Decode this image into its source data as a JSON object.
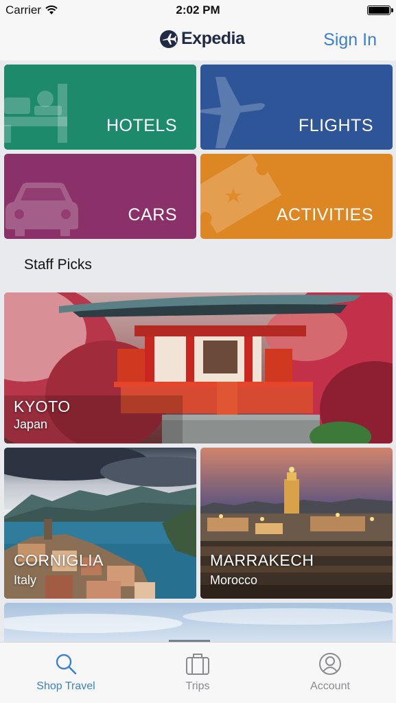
{
  "status_bar": {
    "carrier": "Carrier",
    "time": "2:02 PM"
  },
  "nav": {
    "logo": "Expedia",
    "sign_in": "Sign In"
  },
  "categories": [
    {
      "label": "HOTELS",
      "color": "#1e8a6c",
      "icon": "bed-icon"
    },
    {
      "label": "FLIGHTS",
      "color": "#2d5597",
      "icon": "airplane-icon"
    },
    {
      "label": "CARS",
      "color": "#8b3169",
      "icon": "car-icon"
    },
    {
      "label": "ACTIVITIES",
      "color": "#dd8724",
      "icon": "ticket-icon"
    }
  ],
  "staff_picks": {
    "heading": "Staff Picks",
    "destinations": [
      {
        "city": "KYOTO",
        "country": "Japan"
      },
      {
        "city": "CORNIGLIA",
        "country": "Italy"
      },
      {
        "city": "MARRAKECH",
        "country": "Morocco"
      }
    ]
  },
  "tab_bar": {
    "active_color": "#3a7fd0",
    "tabs": [
      {
        "label": "Shop Travel",
        "icon": "search-icon",
        "active": true
      },
      {
        "label": "Trips",
        "icon": "suitcase-icon",
        "active": false
      },
      {
        "label": "Account",
        "icon": "person-icon",
        "active": false
      }
    ]
  }
}
